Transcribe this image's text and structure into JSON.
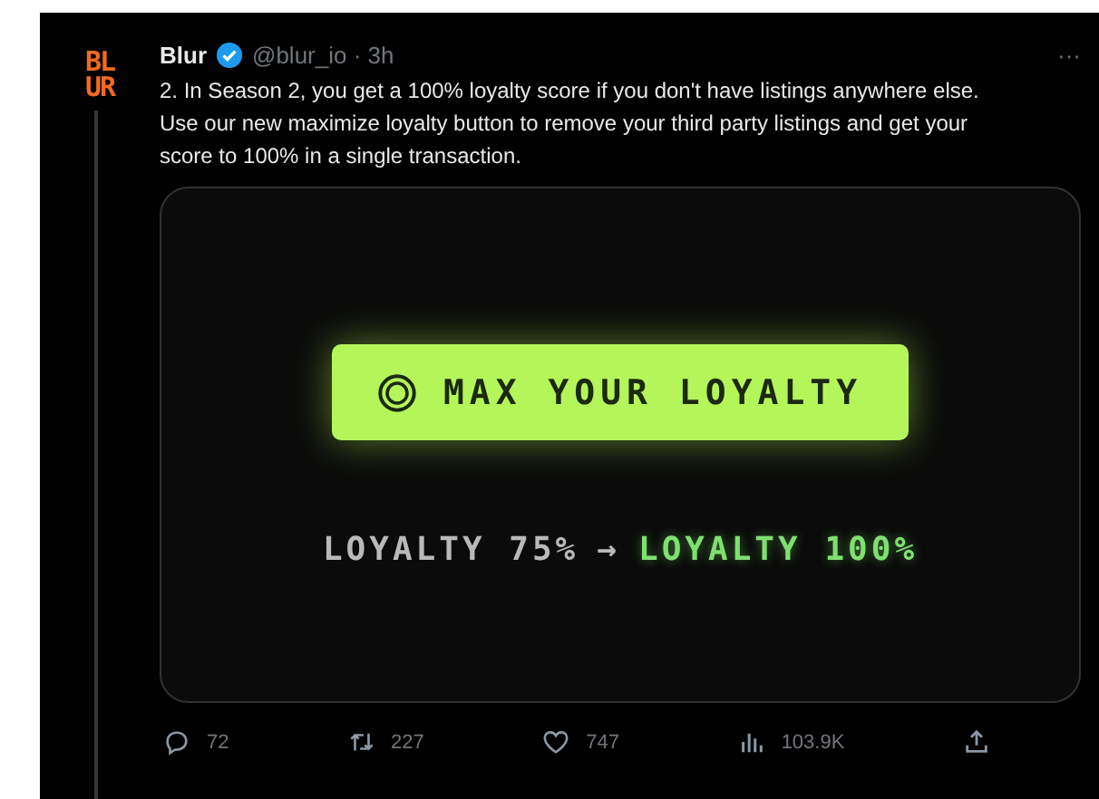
{
  "tweet": {
    "logo": [
      "BL",
      "UR"
    ],
    "author": "Blur",
    "verified": true,
    "handle": "@blur_io · 3h",
    "more": "···",
    "text": "2. In Season 2, you get a 100% loyalty score if you don't have listings anywhere else. Use our new maximize loyalty button to remove your third party listings and get your score to 100% in a single transaction.",
    "media": {
      "button": "MAX YOUR LOYALTY",
      "from": "LOYALTY 75%",
      "arrow": "→",
      "to": "LOYALTY 100%"
    },
    "actions": [
      {
        "kind": "reply",
        "count": "72"
      },
      {
        "kind": "retweet",
        "count": "227"
      },
      {
        "kind": "like",
        "count": "747"
      },
      {
        "kind": "views",
        "count": "103.9K"
      },
      {
        "kind": "share"
      }
    ]
  }
}
